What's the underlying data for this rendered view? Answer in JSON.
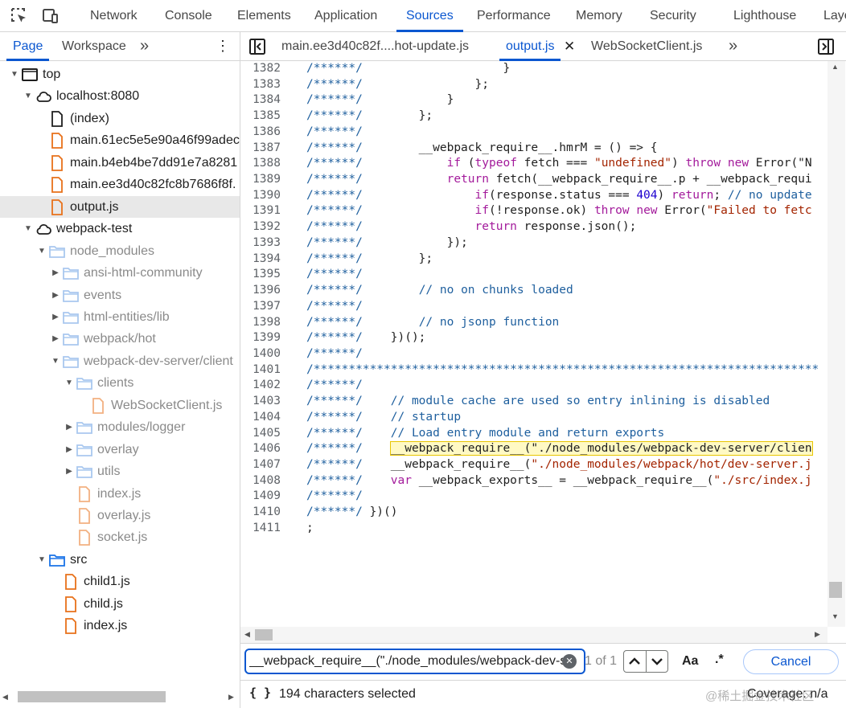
{
  "toolbar": {
    "tabs": [
      "Network",
      "Console",
      "Elements",
      "Application",
      "Sources",
      "Performance",
      "Memory",
      "Security",
      "Lighthouse",
      "Laye"
    ],
    "active_tab": "Sources"
  },
  "navigator": {
    "tabs": [
      "Page",
      "Workspace"
    ],
    "active_tab": "Page",
    "more": "»",
    "menu": "⋮"
  },
  "tree": [
    {
      "label": "top",
      "depth": 0,
      "type": "frame",
      "expanded": true
    },
    {
      "label": "localhost:8080",
      "depth": 1,
      "type": "cloud",
      "expanded": true
    },
    {
      "label": "(index)",
      "depth": 2,
      "type": "doc"
    },
    {
      "label": "main.61ec5e5e90a46f99adec",
      "depth": 2,
      "type": "js"
    },
    {
      "label": "main.b4eb4be7dd91e7a8281",
      "depth": 2,
      "type": "js"
    },
    {
      "label": "main.ee3d40c82fc8b7686f8f.",
      "depth": 2,
      "type": "js"
    },
    {
      "label": "output.js",
      "depth": 2,
      "type": "js",
      "selected": true
    },
    {
      "label": "webpack-test",
      "depth": 1,
      "type": "cloud",
      "expanded": true
    },
    {
      "label": "node_modules",
      "depth": 2,
      "type": "folder",
      "expanded": true,
      "dim": true
    },
    {
      "label": "ansi-html-community",
      "depth": 3,
      "type": "folder",
      "expanded": false,
      "dim": true
    },
    {
      "label": "events",
      "depth": 3,
      "type": "folder",
      "expanded": false,
      "dim": true
    },
    {
      "label": "html-entities/lib",
      "depth": 3,
      "type": "folder",
      "expanded": false,
      "dim": true
    },
    {
      "label": "webpack/hot",
      "depth": 3,
      "type": "folder",
      "expanded": false,
      "dim": true
    },
    {
      "label": "webpack-dev-server/client",
      "depth": 3,
      "type": "folder",
      "expanded": true,
      "dim": true
    },
    {
      "label": "clients",
      "depth": 4,
      "type": "folder",
      "expanded": true,
      "dim": true
    },
    {
      "label": "WebSocketClient.js",
      "depth": 5,
      "type": "js",
      "dim": true
    },
    {
      "label": "modules/logger",
      "depth": 4,
      "type": "folder",
      "expanded": false,
      "dim": true
    },
    {
      "label": "overlay",
      "depth": 4,
      "type": "folder",
      "expanded": false,
      "dim": true
    },
    {
      "label": "utils",
      "depth": 4,
      "type": "folder",
      "expanded": false,
      "dim": true
    },
    {
      "label": "index.js",
      "depth": 4,
      "type": "js",
      "dim": true
    },
    {
      "label": "overlay.js",
      "depth": 4,
      "type": "js",
      "dim": true
    },
    {
      "label": "socket.js",
      "depth": 4,
      "type": "js",
      "dim": true
    },
    {
      "label": "src",
      "depth": 2,
      "type": "folder",
      "expanded": true
    },
    {
      "label": "child1.js",
      "depth": 3,
      "type": "js"
    },
    {
      "label": "child.js",
      "depth": 3,
      "type": "js"
    },
    {
      "label": "index.js",
      "depth": 3,
      "type": "js"
    }
  ],
  "editor": {
    "tabs": [
      {
        "label": "main.ee3d40c82f....hot-update.js",
        "active": false
      },
      {
        "label": "output.js",
        "active": true,
        "closable": true
      },
      {
        "label": "WebSocketClient.js",
        "active": false
      }
    ],
    "more": "»",
    "close_glyph": "✕"
  },
  "code_lines": [
    {
      "n": "1382",
      "segs": [
        [
          "c",
          "/******/"
        ],
        [
          "t",
          "                    }"
        ]
      ]
    },
    {
      "n": "1383",
      "segs": [
        [
          "c",
          "/******/"
        ],
        [
          "t",
          "                };"
        ]
      ]
    },
    {
      "n": "1384",
      "segs": [
        [
          "c",
          "/******/"
        ],
        [
          "t",
          "            }"
        ]
      ]
    },
    {
      "n": "1385",
      "segs": [
        [
          "c",
          "/******/"
        ],
        [
          "t",
          "        };"
        ]
      ]
    },
    {
      "n": "1386",
      "segs": [
        [
          "c",
          "/******/"
        ]
      ]
    },
    {
      "n": "1387",
      "segs": [
        [
          "c",
          "/******/"
        ],
        [
          "t",
          "        __webpack_require__.hmrM = () => {"
        ]
      ]
    },
    {
      "n": "1388",
      "segs": [
        [
          "c",
          "/******/"
        ],
        [
          "t",
          "            "
        ],
        [
          "k",
          "if"
        ],
        [
          "t",
          " ("
        ],
        [
          "k",
          "typeof"
        ],
        [
          "t",
          " fetch === "
        ],
        [
          "s",
          "\"undefined\""
        ],
        [
          "t",
          ") "
        ],
        [
          "k",
          "throw"
        ],
        [
          "t",
          " "
        ],
        [
          "k",
          "new"
        ],
        [
          "t",
          " Error(\"N"
        ]
      ]
    },
    {
      "n": "1389",
      "segs": [
        [
          "c",
          "/******/"
        ],
        [
          "t",
          "            "
        ],
        [
          "k",
          "return"
        ],
        [
          "t",
          " fetch(__webpack_require__.p + __webpack_requi"
        ]
      ]
    },
    {
      "n": "1390",
      "segs": [
        [
          "c",
          "/******/"
        ],
        [
          "t",
          "                "
        ],
        [
          "k",
          "if"
        ],
        [
          "t",
          "(response.status === "
        ],
        [
          "n",
          "404"
        ],
        [
          "t",
          ") "
        ],
        [
          "k",
          "return"
        ],
        [
          "t",
          "; "
        ],
        [
          "c",
          "// no update"
        ]
      ]
    },
    {
      "n": "1391",
      "segs": [
        [
          "c",
          "/******/"
        ],
        [
          "t",
          "                "
        ],
        [
          "k",
          "if"
        ],
        [
          "t",
          "(!response.ok) "
        ],
        [
          "k",
          "throw"
        ],
        [
          "t",
          " "
        ],
        [
          "k",
          "new"
        ],
        [
          "t",
          " Error("
        ],
        [
          "s",
          "\"Failed to fetc"
        ]
      ]
    },
    {
      "n": "1392",
      "segs": [
        [
          "c",
          "/******/"
        ],
        [
          "t",
          "                "
        ],
        [
          "k",
          "return"
        ],
        [
          "t",
          " response.json();"
        ]
      ]
    },
    {
      "n": "1393",
      "segs": [
        [
          "c",
          "/******/"
        ],
        [
          "t",
          "            });"
        ]
      ]
    },
    {
      "n": "1394",
      "segs": [
        [
          "c",
          "/******/"
        ],
        [
          "t",
          "        };"
        ]
      ]
    },
    {
      "n": "1395",
      "segs": [
        [
          "c",
          "/******/"
        ]
      ]
    },
    {
      "n": "1396",
      "segs": [
        [
          "c",
          "/******/"
        ],
        [
          "t",
          "        "
        ],
        [
          "c",
          "// no on chunks loaded"
        ]
      ]
    },
    {
      "n": "1397",
      "segs": [
        [
          "c",
          "/******/"
        ]
      ]
    },
    {
      "n": "1398",
      "segs": [
        [
          "c",
          "/******/"
        ],
        [
          "t",
          "        "
        ],
        [
          "c",
          "// no jsonp function"
        ]
      ]
    },
    {
      "n": "1399",
      "segs": [
        [
          "c",
          "/******/"
        ],
        [
          "t",
          "    })();"
        ]
      ]
    },
    {
      "n": "1400",
      "segs": [
        [
          "c",
          "/******/"
        ]
      ]
    },
    {
      "n": "1401",
      "segs": [
        [
          "c",
          "/************************************************************************"
        ]
      ]
    },
    {
      "n": "1402",
      "segs": [
        [
          "c",
          "/******/"
        ]
      ]
    },
    {
      "n": "1403",
      "segs": [
        [
          "c",
          "/******/"
        ],
        [
          "t",
          "    "
        ],
        [
          "c",
          "// module cache are used so entry inlining is disabled"
        ]
      ]
    },
    {
      "n": "1404",
      "segs": [
        [
          "c",
          "/******/"
        ],
        [
          "t",
          "    "
        ],
        [
          "c",
          "// startup"
        ]
      ]
    },
    {
      "n": "1405",
      "segs": [
        [
          "c",
          "/******/"
        ],
        [
          "t",
          "    "
        ],
        [
          "c",
          "// Load entry module and return exports"
        ]
      ]
    },
    {
      "n": "1406",
      "segs": [
        [
          "c",
          "/******/"
        ],
        [
          "t",
          "    "
        ],
        [
          "h",
          "__webpack_require__(\"./node_modules/webpack-dev-server/clien"
        ]
      ]
    },
    {
      "n": "1407",
      "segs": [
        [
          "c",
          "/******/"
        ],
        [
          "t",
          "    __webpack_require__("
        ],
        [
          "s",
          "\"./node_modules/webpack/hot/dev-server.j"
        ]
      ]
    },
    {
      "n": "1408",
      "segs": [
        [
          "c",
          "/******/"
        ],
        [
          "t",
          "    "
        ],
        [
          "k",
          "var"
        ],
        [
          "t",
          " __webpack_exports__ = __webpack_require__("
        ],
        [
          "s",
          "\"./src/index.j"
        ]
      ]
    },
    {
      "n": "1409",
      "segs": [
        [
          "c",
          "/******/"
        ]
      ]
    },
    {
      "n": "1410",
      "segs": [
        [
          "c",
          "/******/"
        ],
        [
          "t",
          " })()"
        ]
      ]
    },
    {
      "n": "1411",
      "segs": [
        [
          "t",
          ";"
        ]
      ]
    }
  ],
  "search": {
    "value": "__webpack_require__(\"./node_modules/webpack-dev-server/client",
    "match_count": "1 of 1",
    "match_case": "Aa",
    "regex": ".*",
    "cancel": "Cancel"
  },
  "status": {
    "braces": "{ }",
    "selection": "194 characters selected",
    "coverage": "Coverage: n/a",
    "watermark": "@稀土掘金技术社区"
  },
  "colors": {
    "accent": "#0b57d0",
    "comment": "#1e5f9e",
    "keyword": "#a31a9b",
    "string": "#a32400",
    "number": "#1c00cf",
    "js_file": "#e8711a",
    "folder": "#6aa3e8",
    "highlight": "#fff9c4"
  }
}
